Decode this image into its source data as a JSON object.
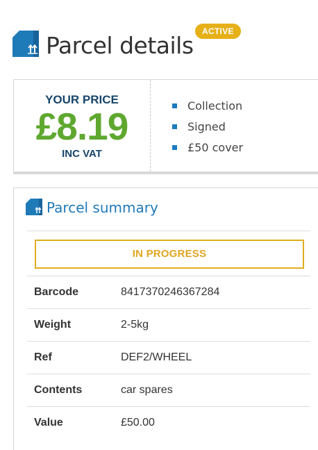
{
  "header": {
    "title": "Parcel details",
    "status_badge": "ACTIVE",
    "icon": "parcel-box-icon"
  },
  "price_card": {
    "label_top": "YOUR PRICE",
    "amount": "£8.19",
    "label_bottom": "INC VAT",
    "features": [
      {
        "label": "Collection"
      },
      {
        "label": "Signed"
      },
      {
        "label": "£50 cover"
      }
    ]
  },
  "summary": {
    "title": "Parcel summary",
    "icon": "parcel-box-icon",
    "status": "IN PROGRESS",
    "rows": [
      {
        "label": "Barcode",
        "value": "8417370246367284"
      },
      {
        "label": "Weight",
        "value": "2-5kg"
      },
      {
        "label": "Ref",
        "value": "DEF2/WHEEL"
      },
      {
        "label": "Contents",
        "value": "car spares"
      },
      {
        "label": "Value",
        "value": "£50.00"
      }
    ]
  },
  "colors": {
    "accent_blue": "#1f7ab8",
    "price_green": "#5fa830",
    "badge_gold": "#e6b017",
    "navy": "#17456b"
  }
}
